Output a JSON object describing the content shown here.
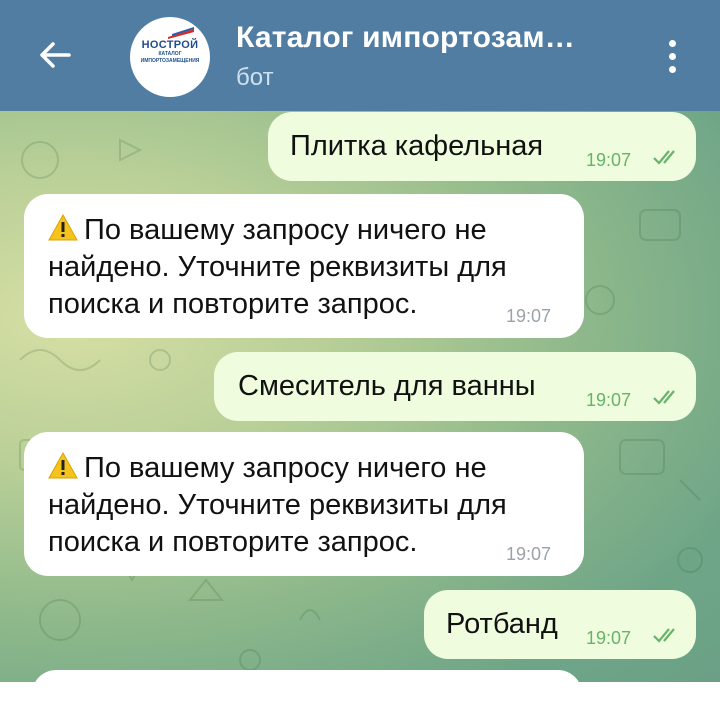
{
  "header": {
    "title": "Каталог импортозам…",
    "subtitle": "бот",
    "logo_main": "НОСТРОЙ",
    "logo_sub1": "КАТАЛОГ",
    "logo_sub2": "ИМПОРТОЗАМЕЩЕНИЯ",
    "color": "#517da2"
  },
  "messages": [
    {
      "direction": "outgoing",
      "text": "Плитка кафельная",
      "time": "19:07",
      "status": "read"
    },
    {
      "direction": "incoming",
      "lines": [
        "По вашему запросу ничего не",
        "найдено. Уточните реквизиты для",
        "поиска и повторите запрос."
      ],
      "time": "19:07",
      "icon": "warning-icon"
    },
    {
      "direction": "outgoing",
      "text": "Смеситель для ванны",
      "time": "19:07",
      "status": "read"
    },
    {
      "direction": "incoming",
      "lines": [
        "По вашему запросу ничего не",
        "найдено. Уточните реквизиты для",
        "поиска и повторите запрос."
      ],
      "time": "19:07",
      "icon": "warning-icon"
    },
    {
      "direction": "outgoing",
      "text": "Ротбанд",
      "time": "19:07",
      "status": "read"
    }
  ],
  "colors": {
    "outgoing_bubble": "#effdde",
    "incoming_bubble": "#ffffff",
    "check": "#68b36a"
  }
}
